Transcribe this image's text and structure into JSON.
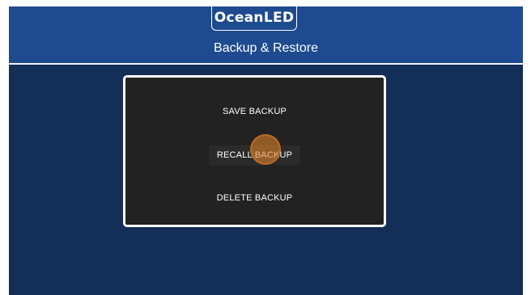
{
  "header": {
    "logo_text": "OceanLED",
    "title": "Backup & Restore"
  },
  "menu": {
    "save_label": "SAVE BACKUP",
    "recall_label": "RECALL BACKUP",
    "delete_label": "DELETE BACKUP"
  },
  "colors": {
    "header_background": "#1e4b8f",
    "page_background": "#132e57",
    "panel_background": "#222222",
    "panel_border": "#ffffff",
    "touch_indicator": "#dc822d"
  }
}
